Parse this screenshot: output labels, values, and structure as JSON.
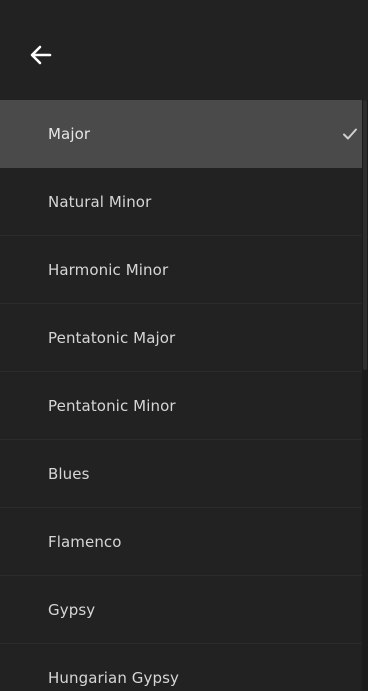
{
  "header": {
    "back_icon": "arrow-left-icon"
  },
  "scale_list": {
    "selected_index": 0,
    "items": [
      {
        "label": "Major",
        "selected": true
      },
      {
        "label": "Natural Minor",
        "selected": false
      },
      {
        "label": "Harmonic Minor",
        "selected": false
      },
      {
        "label": "Pentatonic Major",
        "selected": false
      },
      {
        "label": "Pentatonic Minor",
        "selected": false
      },
      {
        "label": "Blues",
        "selected": false
      },
      {
        "label": "Flamenco",
        "selected": false
      },
      {
        "label": "Gypsy",
        "selected": false
      },
      {
        "label": "Hungarian Gypsy",
        "selected": false
      }
    ],
    "check_icon": "checkmark-icon"
  },
  "colors": {
    "background": "#222222",
    "selected_row": "#4a4a4a",
    "text": "#d6d6d6",
    "icon": "#ffffff"
  }
}
